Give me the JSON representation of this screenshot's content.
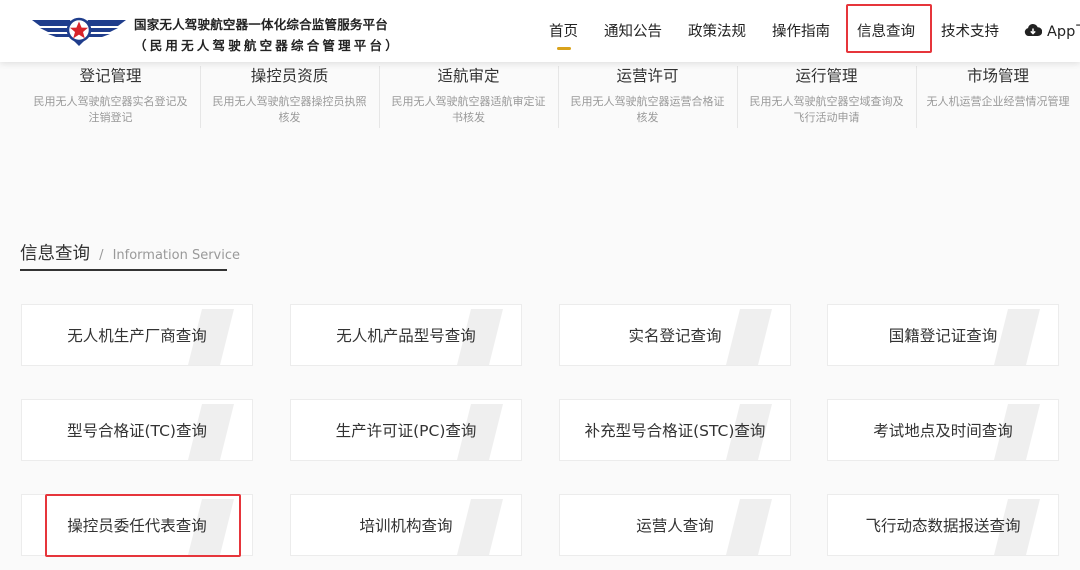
{
  "brand": {
    "line1": "国家无人驾驶航空器一体化综合监管服务平台",
    "line2": "（民用无人驾驶航空器综合管理平台）",
    "logo_icon": "wings-star-logo-icon"
  },
  "nav": {
    "items": [
      {
        "label": "首页",
        "active": true
      },
      {
        "label": "通知公告",
        "active": false
      },
      {
        "label": "政策法规",
        "active": false
      },
      {
        "label": "操作指南",
        "active": false
      },
      {
        "label": "信息查询",
        "active": false,
        "highlighted": true
      },
      {
        "label": "技术支持",
        "active": false
      },
      {
        "label": "App下",
        "active": false,
        "icon": "cloud-download-icon"
      }
    ],
    "active_accent": "#d9a21b"
  },
  "services": [
    {
      "title": "登记管理",
      "desc": "民用无人驾驶航空器实名登记及注销登记"
    },
    {
      "title": "操控员资质",
      "desc": "民用无人驾驶航空器操控员执照核发"
    },
    {
      "title": "适航审定",
      "desc": "民用无人驾驶航空器适航审定证书核发"
    },
    {
      "title": "运营许可",
      "desc": "民用无人驾驶航空器运营合格证核发"
    },
    {
      "title": "运行管理",
      "desc": "民用无人驾驶航空器空域查询及飞行活动申请"
    },
    {
      "title": "市场管理",
      "desc": "无人机运营企业经营情况管理"
    }
  ],
  "section": {
    "title": "信息查询",
    "separator": "/",
    "subtitle": "Information Service"
  },
  "cards": [
    {
      "label": "无人机生产厂商查询"
    },
    {
      "label": "无人机产品型号查询"
    },
    {
      "label": "实名登记查询"
    },
    {
      "label": "国籍登记证查询"
    },
    {
      "label": "型号合格证(TC)查询"
    },
    {
      "label": "生产许可证(PC)查询"
    },
    {
      "label": "补充型号合格证(STC)查询"
    },
    {
      "label": "考试地点及时间查询"
    },
    {
      "label": "操控员委任代表查询",
      "highlighted": true
    },
    {
      "label": "培训机构查询"
    },
    {
      "label": "运营人查询"
    },
    {
      "label": "飞行动态数据报送查询"
    }
  ],
  "colors": {
    "highlight_border": "#e6353b",
    "logo_blue": "#1f3d8c",
    "logo_red": "#d8232a"
  }
}
